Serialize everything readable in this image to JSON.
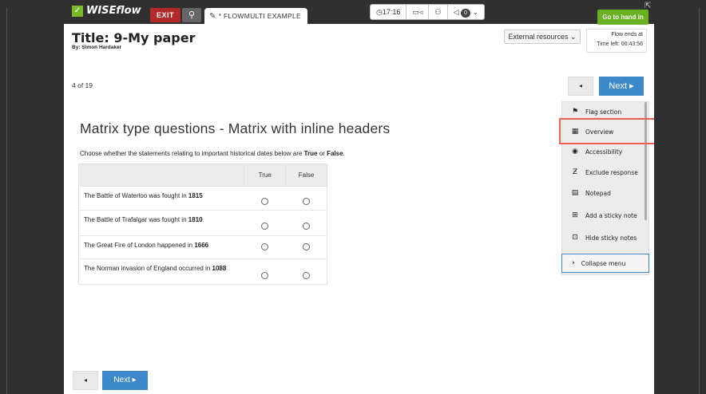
{
  "topbar": {
    "logo": "WISEflow",
    "exit": "EXIT",
    "flow_tab": "* FLOWMULTI EXAMPLE",
    "timer": "17:16",
    "badge_count": "0",
    "hand_in": "Go to hand in"
  },
  "header": {
    "title": "Title: 9-My paper",
    "byline": "By: Simon Hardaker",
    "external_resources": "External resources",
    "flow_ends_label": "Flow ends at",
    "time_left": "Time left: 00:43:56"
  },
  "nav": {
    "page_count": "4 of 19",
    "prev": "◂",
    "next": "Next ▸"
  },
  "question": {
    "title": "Matrix type questions - Matrix with inline headers",
    "instruction_pre": "Choose whether the statements relating to important historical dates below are ",
    "instruction_true": "True",
    "instruction_mid": " or ",
    "instruction_false": "False",
    "instruction_end": ".",
    "columns": [
      "True",
      "False"
    ],
    "rows": [
      {
        "text": "The Battle of Waterloo was fought in ",
        "bold": "1815"
      },
      {
        "text": "The Battle of Trafalgar was fought in ",
        "bold": "1810"
      },
      {
        "text": "The Great Fire of London happened in ",
        "bold": "1666"
      },
      {
        "text": "The Norman invasion of England occurred in ",
        "bold": "1088"
      }
    ]
  },
  "side_menu": {
    "items": [
      {
        "label": "Flag section",
        "icon": "flag-icon"
      },
      {
        "label": "Overview",
        "icon": "calendar-grid-icon"
      },
      {
        "label": "Accessibility",
        "icon": "accessibility-icon"
      },
      {
        "label": "Exclude response",
        "icon": "exclude-icon"
      },
      {
        "label": "Notepad",
        "icon": "notepad-icon"
      },
      {
        "label": "Add a sticky note",
        "icon": "sticky-add-icon"
      },
      {
        "label": "Hide sticky notes",
        "icon": "sticky-hide-icon"
      }
    ],
    "collapse": "Collapse menu"
  },
  "colors": {
    "accent_blue": "#3d88c8",
    "handin_green": "#6ab023",
    "exit_red": "#b32a2a",
    "highlight": "#e8604f"
  }
}
